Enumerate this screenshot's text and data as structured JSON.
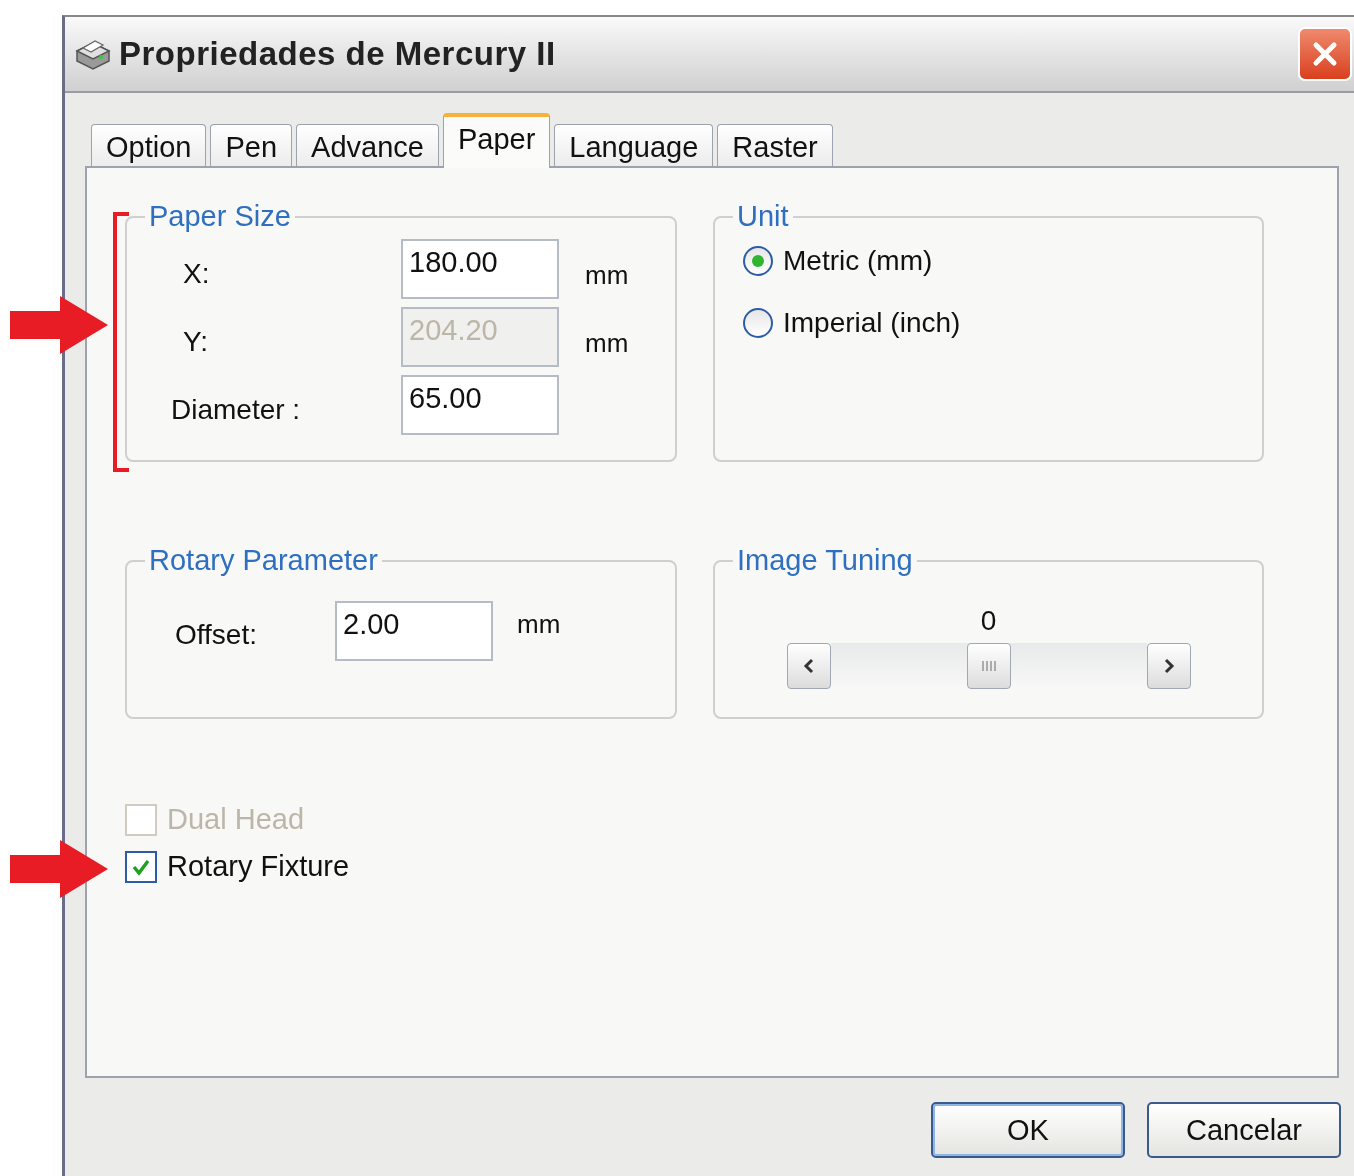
{
  "window": {
    "title": "Propriedades de Mercury II"
  },
  "tabs": [
    {
      "label": "Option",
      "selected": false
    },
    {
      "label": "Pen",
      "selected": false
    },
    {
      "label": "Advance",
      "selected": false
    },
    {
      "label": "Paper",
      "selected": true
    },
    {
      "label": "Language",
      "selected": false
    },
    {
      "label": "Raster",
      "selected": false
    }
  ],
  "paper_size": {
    "title": "Paper Size",
    "fields": [
      {
        "label": "X:",
        "value": "180.00",
        "unit": "mm",
        "disabled": false
      },
      {
        "label": "Y:",
        "value": "204.20",
        "unit": "mm",
        "disabled": true
      },
      {
        "label": "Diameter :",
        "value": "65.00",
        "disabled": false
      }
    ]
  },
  "unit": {
    "title": "Unit",
    "options": [
      {
        "label": "Metric (mm)",
        "selected": true
      },
      {
        "label": "Imperial (inch)",
        "selected": false
      }
    ]
  },
  "rotary_parameter": {
    "title": "Rotary Parameter",
    "label": "Offset:",
    "value": "2.00",
    "unit": "mm"
  },
  "image_tuning": {
    "title": "Image Tuning",
    "reading": "0",
    "level": 0.5
  },
  "checkboxes": [
    {
      "label": "Dual Head",
      "checked": false,
      "disabled": true
    },
    {
      "label": "Rotary Fixture",
      "checked": true,
      "disabled": false
    }
  ],
  "buttons": [
    {
      "label": "OK",
      "default": true
    },
    {
      "label": "Cancelar",
      "default": false
    }
  ],
  "annotations": [
    {
      "kind": "bracket"
    },
    {
      "kind": "arrow"
    },
    {
      "kind": "arrow"
    }
  ]
}
